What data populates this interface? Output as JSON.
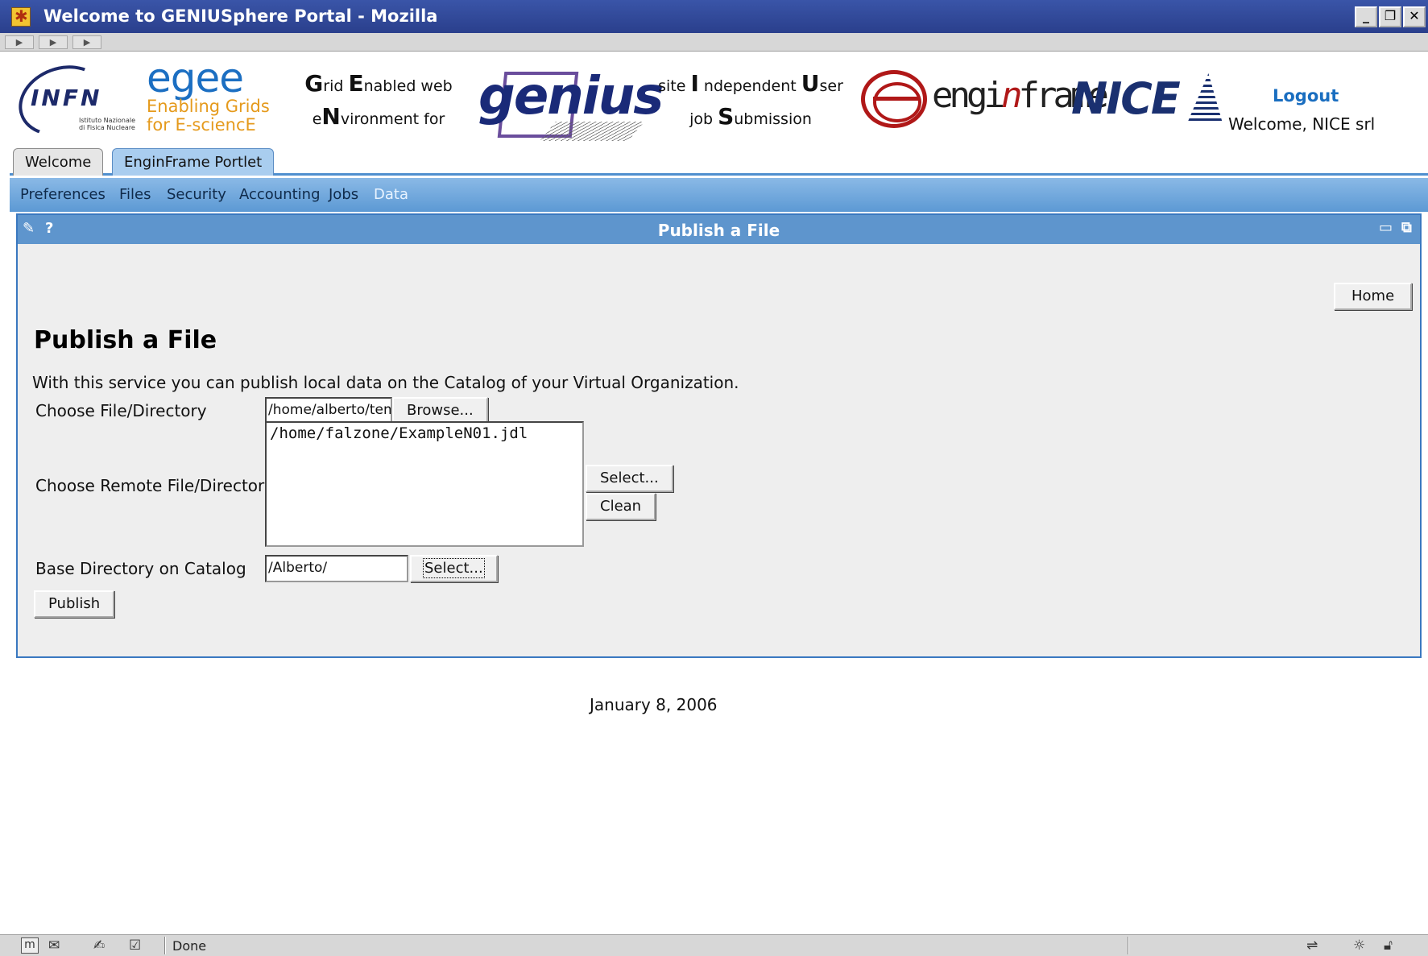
{
  "window": {
    "title": "Welcome to GENIUSphere Portal - Mozilla",
    "controls": [
      "minimize",
      "restore",
      "close"
    ]
  },
  "header": {
    "infn": {
      "text": "INFN",
      "sub_line1": "Istituto Nazionale",
      "sub_line2": "di Fisica Nucleare"
    },
    "egee": {
      "word": "egee",
      "line1": "Enabling Grids",
      "line2": "for E-sciencE"
    },
    "grid_tagline": {
      "l1_a": "G",
      "l1_b": "rid ",
      "l1_c": "E",
      "l1_d": "nabled web",
      "l2_a": "e",
      "l2_b": "N",
      "l2_c": "vironment for"
    },
    "genius": {
      "word": "genius"
    },
    "site_tagline": {
      "l1_a": "site ",
      "l1_b": "I",
      "l1_c": " ndependent ",
      "l1_d": "U",
      "l1_e": "ser",
      "l2_a": "job ",
      "l2_b": "S",
      "l2_c": "ubmission"
    },
    "enginframe": {
      "a": "engi",
      "b": "n",
      "c": "frame"
    },
    "nice": {
      "word": "NICE"
    },
    "logout_label": "Logout",
    "welcome_text": "Welcome, NICE srl"
  },
  "tabs": [
    {
      "label": "Welcome",
      "active": false
    },
    {
      "label": "EnginFrame Portlet",
      "active": true
    }
  ],
  "submenu": [
    {
      "label": "Preferences"
    },
    {
      "label": "Files"
    },
    {
      "label": "Security"
    },
    {
      "label": "Accounting"
    },
    {
      "label": "Jobs"
    },
    {
      "label": "Data",
      "current": true
    }
  ],
  "portlet": {
    "title": "Publish a File",
    "edit_icon": "pencil-icon",
    "help_label": "?",
    "minimize_icon": "minimize-icon",
    "maximize_icon": "maximize-icon",
    "home_label": "Home",
    "heading": "Publish a File",
    "intro": "With this service you can publish local data on the Catalog of your Virtual Organization.",
    "form": {
      "local_label": "Choose File/Directory",
      "local_value": "/home/alberto/tem",
      "browse_label": "Browse...",
      "remote_label": "Choose Remote File/Directory",
      "remote_value": "/home/falzone/ExampleN01.jdl",
      "remote_select_label": "Select...",
      "remote_clean_label": "Clean",
      "base_label": "Base Directory on Catalog",
      "base_value": "/Alberto/",
      "base_select_label": "Select...",
      "publish_label": "Publish"
    }
  },
  "footer_date": "January 8, 2006",
  "statusbar": {
    "text": "Done",
    "icons": [
      "navigator-icon",
      "mail-icon",
      "composer-icon",
      "addressbook-icon",
      "online-icon",
      "security-icon",
      "lock-icon"
    ]
  },
  "colors": {
    "titlebar": "#2a3f8c",
    "submenu": "#5c99d4",
    "portlet_header": "#5e95cd",
    "link": "#1a6ec0"
  }
}
